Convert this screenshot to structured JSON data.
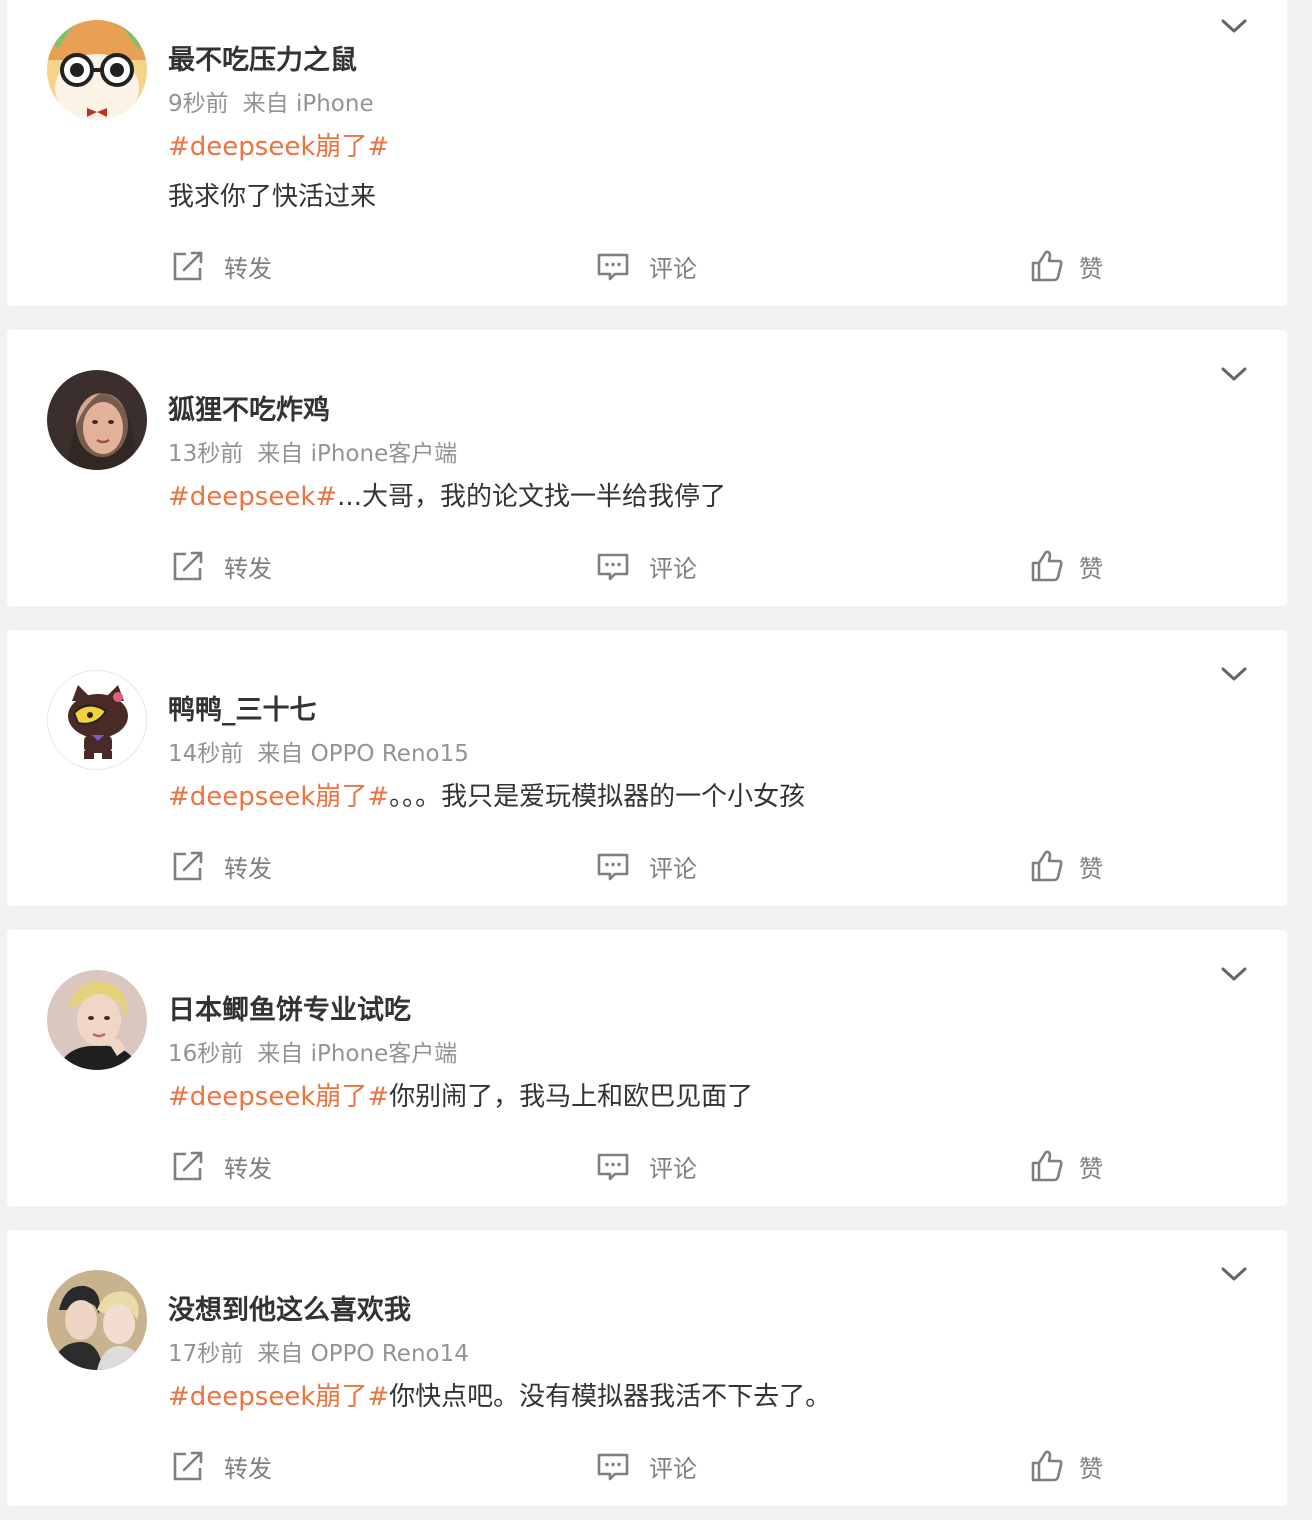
{
  "posts": [
    {
      "username": "最不吃压力之鼠",
      "time": "9秒前",
      "source": "来自 iPhone",
      "topic": "#deepseek崩了#",
      "text": "我求你了快活过来",
      "actions": {
        "repost": "转发",
        "comment": "评论",
        "like": "赞"
      }
    },
    {
      "username": "狐狸不吃炸鸡",
      "time": "13秒前",
      "source": "来自 iPhone客户端",
      "topic": "#deepseek#",
      "text": "...大哥，我的论文找一半给我停了",
      "actions": {
        "repost": "转发",
        "comment": "评论",
        "like": "赞"
      }
    },
    {
      "username": "鸭鸭_三十七",
      "time": "14秒前",
      "source": "来自 OPPO Reno15",
      "topic": "#deepseek崩了#",
      "text": "。。。我只是爱玩模拟器的一个小女孩",
      "actions": {
        "repost": "转发",
        "comment": "评论",
        "like": "赞"
      }
    },
    {
      "username": "日本鲫鱼饼专业试吃",
      "time": "16秒前",
      "source": "来自 iPhone客户端",
      "topic": "#deepseek崩了#",
      "text": "你别闹了，我马上和欧巴见面了",
      "actions": {
        "repost": "转发",
        "comment": "评论",
        "like": "赞"
      }
    },
    {
      "username": "没想到他这么喜欢我",
      "time": "17秒前",
      "source": "来自 OPPO Reno14",
      "topic": "#deepseek崩了#",
      "text": "你快点吧。没有模拟器我活不下去了。",
      "actions": {
        "repost": "转发",
        "comment": "评论",
        "like": "赞"
      }
    }
  ],
  "colors": {
    "topic": "#eb7340",
    "background": "#f2f2f2",
    "card": "#ffffff",
    "meta": "#939393",
    "action_label": "#7f7f7f"
  },
  "icons": {
    "repost": "repost-icon",
    "comment": "comment-icon",
    "like": "thumbs-up-icon",
    "menu": "chevron-down-icon"
  }
}
